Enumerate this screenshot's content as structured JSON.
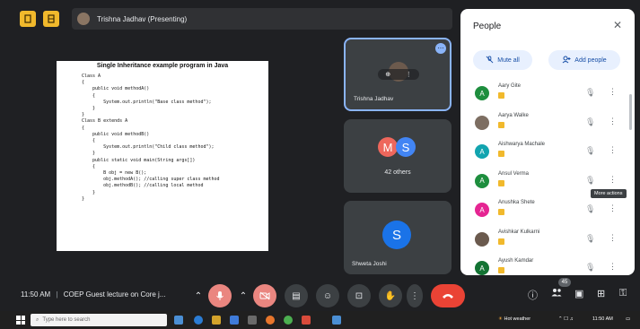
{
  "meeting": {
    "presenter_label": "Trishna Jadhav (Presenting)",
    "time": "11:50 AM",
    "title": "COEP Guest lecture on Core j..."
  },
  "slide": {
    "title": "Single Inheritance example program in Java",
    "code_lines": [
      "Class A",
      "{",
      "    public void methodA()",
      "    {",
      "        System.out.println(\"Base class method\");",
      "    }",
      "}",
      "Class B extends A",
      "{",
      "    public void methodB()",
      "    {",
      "        System.out.println(\"Child class method\");",
      "    }",
      "    public static void main(String args[])",
      "    {",
      "        B obj = new B();",
      "        obj.methodA(); //calling super class method",
      "        obj.methodB(); //calling local method",
      "    }",
      "}"
    ]
  },
  "tiles": {
    "trishna": {
      "name": "Trishna Jadhav"
    },
    "others": {
      "label": "42 others",
      "initials": [
        "M",
        "S"
      ]
    },
    "shweta": {
      "name": "Shweta Joshi",
      "initial": "S"
    }
  },
  "people_panel": {
    "title": "People",
    "mute_all": "Mute all",
    "add_people": "Add people",
    "more_actions_tooltip": "More actions",
    "participants": [
      {
        "name": "Aary Gite",
        "initial": "A",
        "color": "#1e8e3e"
      },
      {
        "name": "Aarya Walke",
        "initial": "",
        "color": "#7d6e62"
      },
      {
        "name": "Aishwarya Machale",
        "initial": "A",
        "color": "#12a4af"
      },
      {
        "name": "Ansul Verma",
        "initial": "A",
        "color": "#1e8e3e"
      },
      {
        "name": "Anushka Shete",
        "initial": "A",
        "color": "#e52592"
      },
      {
        "name": "Avishkar Kulkarni",
        "initial": "",
        "color": "#6b5a4e"
      },
      {
        "name": "Ayush Kamdar",
        "initial": "A",
        "color": "#137333"
      }
    ]
  },
  "controls": {
    "participant_count": "45"
  },
  "taskbar": {
    "search_placeholder": "Type here to search",
    "weather": "Hot weather",
    "clock_time": "11:50 AM"
  }
}
